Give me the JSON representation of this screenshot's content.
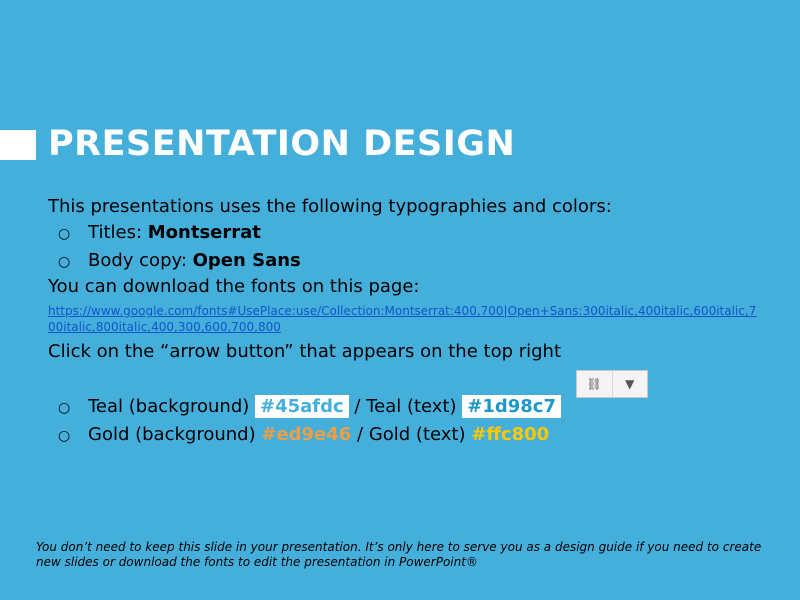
{
  "slide": {
    "title": "PRESENTATION DESIGN",
    "intro": "This presentations uses the following typographies and colors:",
    "bullets_fonts": [
      {
        "prefix": "Titles: ",
        "value": "Montserrat"
      },
      {
        "prefix": "Body copy: ",
        "value": "Open Sans"
      }
    ],
    "download_text": "You can download the fonts on this page:",
    "download_link": "https://www.google.com/fonts#UsePlace:use/Collection:Montserrat:400,700|Open+Sans:300italic,400italic,600italic,700italic,800italic,400,300,600,700,800",
    "arrow_instruction": "Click on the “arrow button” that appears on the top right",
    "colors": [
      {
        "label1": "Teal (background) ",
        "hex1": "#45afdc",
        "sep": " / Teal (text) ",
        "hex2": "#1d98c7"
      },
      {
        "label1": "Gold (background) ",
        "hex1": "#ed9e46",
        "sep": " / Gold (text) ",
        "hex2": "#ffc800"
      }
    ],
    "footer": "You don’t need to keep this slide in your presentation. It’s only here to serve you as a design guide if you need to create new slides or download the fonts to edit the presentation in PowerPoint®"
  },
  "widget": {
    "link_icon": "link-icon",
    "download_icon": "download-arrow-icon"
  },
  "theme": {
    "background": "#45afdc",
    "teal_text": "#1d98c7",
    "gold_bg": "#ed9e46",
    "gold_text": "#ffc800"
  }
}
